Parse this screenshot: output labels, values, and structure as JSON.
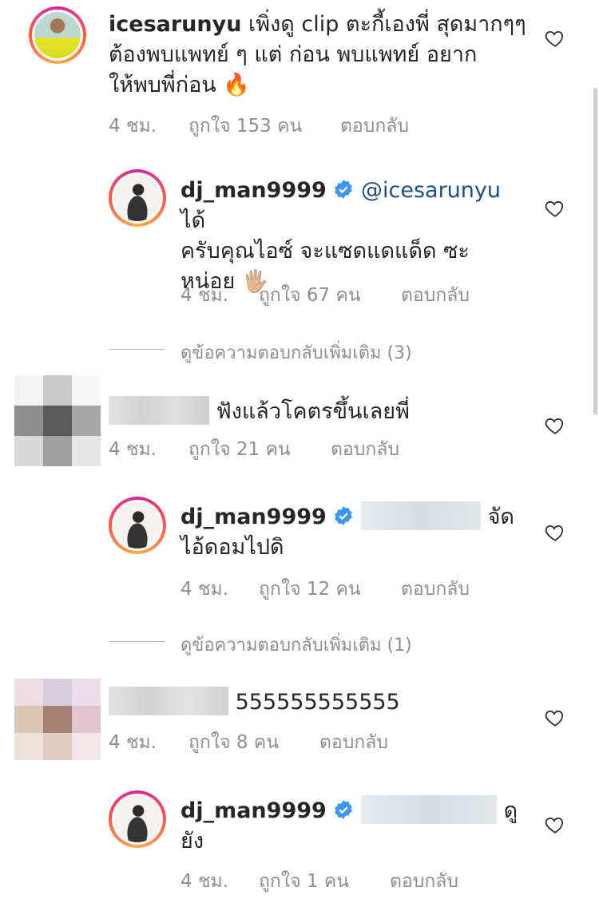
{
  "comments": [
    {
      "username": "icesarunyu",
      "text": "เพิ่งดู clip ตะกี้เองพี่ สุดมากๆๆ ต้องพบแพทย์ ๆ แต่ ก่อน พบแพทย์ อยากให้พบพี่ก่อน",
      "emoji": "🔥",
      "lines": [
        "เพิ่งดู clip ตะกี้เองพี่ สุดมากๆๆ",
        "ต้องพบแพทย์ ๆ แต่ ก่อน พบแพทย์ อยาก",
        "ให้พบพี่ก่อน"
      ],
      "time": "4 ชม.",
      "likes": "ถูกใจ 153 คน",
      "reply": "ตอบกลับ"
    },
    {
      "username": "dj_man9999",
      "mention": "@icesarunyu",
      "lines": [
        "ได้",
        "ครับคุณไอซ์ จะแซดแดแด็ด ซะ",
        "หน่อย"
      ],
      "emoji": "🖐🏼",
      "time": "4 ชม.",
      "likes": "ถูกใจ 67 คน",
      "reply": "ตอบกลับ"
    },
    {
      "view_more": "ดูข้อความตอบกลับเพิ่มเติม (3)"
    },
    {
      "text": "ฟังแล้วโคตรขึ้นเลยพี่",
      "time": "4 ชม.",
      "likes": "ถูกใจ 21 คน",
      "reply": "ตอบกลับ"
    },
    {
      "username": "dj_man9999",
      "lines": [
        "จัด",
        "ไอ้ดอมไปดิ"
      ],
      "time": "4 ชม.",
      "likes": "ถูกใจ 12 คน",
      "reply": "ตอบกลับ"
    },
    {
      "view_more": "ดูข้อความตอบกลับเพิ่มเติม (1)"
    },
    {
      "text": "555555555555",
      "time": "4 ชม.",
      "likes": "ถูกใจ 8 คน",
      "reply": "ตอบกลับ"
    },
    {
      "username": "dj_man9999",
      "lines": [
        "ดู",
        "ยัง"
      ],
      "time": "4 ชม.",
      "likes": "ถูกใจ 1 คน",
      "reply": "ตอบกลับ"
    }
  ],
  "colors": {
    "meta": "#8e8e8e",
    "mention": "#1f4e86",
    "verified": "#3897f0"
  },
  "icons": {
    "heart": "heart-outline-icon",
    "verified": "verified-badge-icon"
  }
}
